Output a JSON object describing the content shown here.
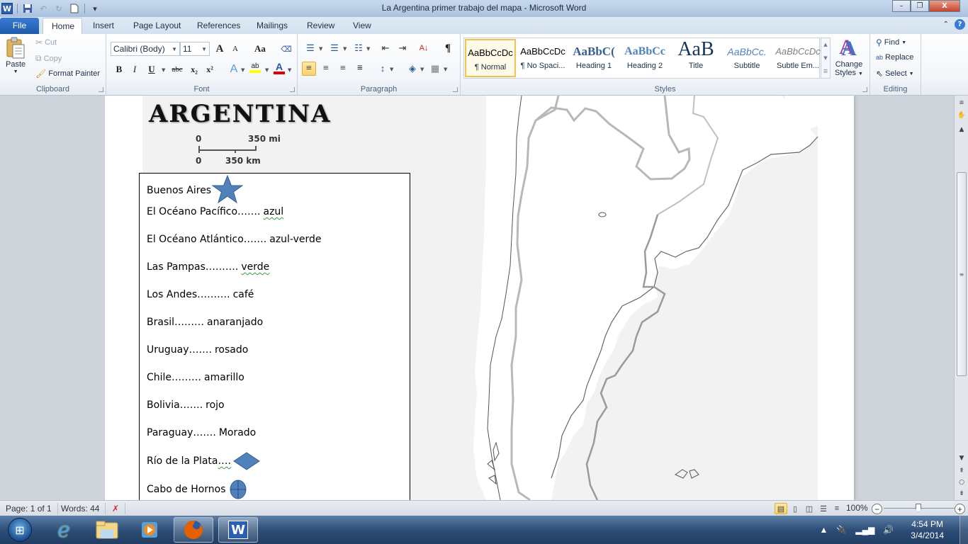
{
  "window": {
    "title": "La Argentina  primer trabajo del mapa  -  Microsoft Word",
    "app_icon": "W",
    "minimize": "–",
    "restore": "❐",
    "close": "X"
  },
  "qat": {
    "save_icon": "💾",
    "undo_icon": "↶",
    "redo_icon": "↻",
    "new_icon": "🗋",
    "customize_icon": "▾"
  },
  "tabs": [
    {
      "label": "File"
    },
    {
      "label": "Home"
    },
    {
      "label": "Insert"
    },
    {
      "label": "Page Layout"
    },
    {
      "label": "References"
    },
    {
      "label": "Mailings"
    },
    {
      "label": "Review"
    },
    {
      "label": "View"
    }
  ],
  "ribbon": {
    "clipboard": {
      "label": "Clipboard",
      "paste": "Paste",
      "cut": "Cut",
      "copy": "Copy",
      "format_painter": "Format Painter"
    },
    "font": {
      "label": "Font",
      "font_name": "Calibri (Body)",
      "font_size": "11",
      "grow": "A",
      "shrink": "A",
      "change_case": "Aa",
      "clear": "A",
      "bold": "B",
      "italic": "I",
      "underline": "U",
      "strike": "abc",
      "subscript": "x₂",
      "superscript": "x²",
      "text_effects": "A",
      "highlight": "ab",
      "font_color": "A",
      "highlight_color": "#ffff00",
      "font_color_value": "#e00000"
    },
    "paragraph": {
      "label": "Paragraph",
      "show_marks": "¶",
      "sort": "A↓"
    },
    "styles": {
      "label": "Styles",
      "items": [
        {
          "preview": "AaBbCcDc",
          "name": "¶ Normal"
        },
        {
          "preview": "AaBbCcDc",
          "name": "¶ No Spaci..."
        },
        {
          "preview": "AaBbC(",
          "name": "Heading 1"
        },
        {
          "preview": "AaBbCc",
          "name": "Heading 2"
        },
        {
          "preview": "AaB",
          "name": "Title"
        },
        {
          "preview": "AaBbCc.",
          "name": "Subtitle"
        },
        {
          "preview": "AaBbCcDc",
          "name": "Subtle Em..."
        }
      ],
      "change_styles_line1": "Change",
      "change_styles_line2": "Styles"
    },
    "editing": {
      "label": "Editing",
      "find": "Find",
      "replace": "Replace",
      "select": "Select"
    }
  },
  "document": {
    "map_title": "ARGENTINA",
    "scale": {
      "mi_zero": "0",
      "mi_value": "350 mi",
      "km_zero": "0",
      "km_value": "350 km"
    },
    "legend": [
      {
        "name": "Buenos Aires",
        "dots": "",
        "color": "",
        "symbol": "star"
      },
      {
        "name": "El Océano Pacífico",
        "dots": "…….",
        "color": "azul"
      },
      {
        "name": "El Océano Atlántico ",
        "dots": "…….",
        "color": "azul-verde"
      },
      {
        "name": "Las Pampas",
        "dots": "……….",
        "color": "verde"
      },
      {
        "name": "Los Andes",
        "dots": "……….",
        "color": "café"
      },
      {
        "name": "Brasil",
        "dots": "……… ",
        "color": "anaranjado"
      },
      {
        "name": "Uruguay",
        "dots": "……. ",
        "color": "rosado"
      },
      {
        "name": "Chile",
        "dots": "……… ",
        "color": "amarillo"
      },
      {
        "name": "Bolivia",
        "dots": "……. ",
        "color": "rojo"
      },
      {
        "name": "Paraguay",
        "dots": "…….  ",
        "color": "Morado"
      },
      {
        "name": "Río de la Plata",
        "dots": "….",
        "color": "",
        "symbol": "diamond"
      },
      {
        "name": "Cabo de Hornos",
        "dots": "",
        "color": "",
        "symbol": "circle-cross"
      }
    ],
    "symbol_color": "#4f81bd"
  },
  "statusbar": {
    "page": "Page: 1 of 1",
    "words": "Words: 44",
    "zoom": "100%",
    "zoom_level_percent": 100
  },
  "taskbar": {
    "time": "4:54 PM",
    "date": "3/4/2014",
    "apps": [
      "start",
      "internet-explorer",
      "file-explorer",
      "media-player",
      "firefox",
      "word"
    ]
  }
}
